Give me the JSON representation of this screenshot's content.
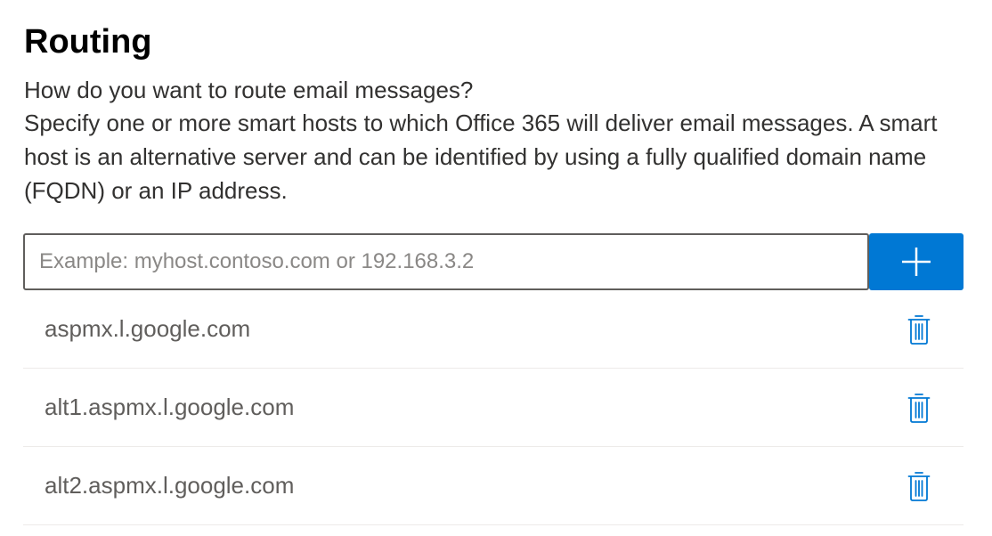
{
  "section": {
    "title": "Routing",
    "question": "How do you want to route email messages?",
    "description": "Specify one or more smart hosts to which Office 365 will deliver email messages. A smart host is an alternative server and can be identified by using a fully qualified domain name (FQDN) or an IP address."
  },
  "host_input": {
    "value": "",
    "placeholder": "Example: myhost.contoso.com or 192.168.3.2"
  },
  "add_button": {
    "icon": "plus-icon"
  },
  "hosts": [
    {
      "name": "aspmx.l.google.com",
      "icon": "delete-icon"
    },
    {
      "name": "alt1.aspmx.l.google.com",
      "icon": "delete-icon"
    },
    {
      "name": "alt2.aspmx.l.google.com",
      "icon": "delete-icon"
    }
  ],
  "colors": {
    "accent": "#0078d4",
    "text": "#323130",
    "muted_text": "#605e5c",
    "divider": "#edebe9"
  }
}
